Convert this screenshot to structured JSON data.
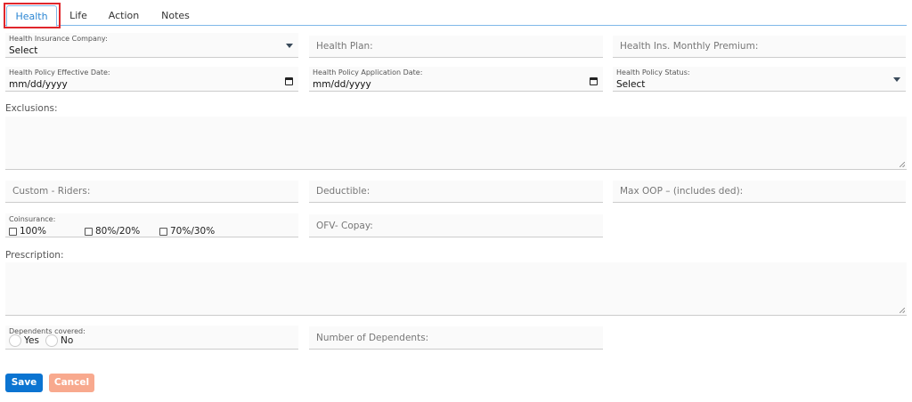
{
  "tabs": [
    "Health",
    "Life",
    "Action",
    "Notes"
  ],
  "fields": {
    "company_label": "Health Insurance Company:",
    "company_value": "Select",
    "plan_placeholder": "Health Plan:",
    "premium_placeholder": "Health Ins. Monthly Premium:",
    "effective_label": "Health Policy Effective Date:",
    "effective_value": "mm/dd/yyyy",
    "application_label": "Health Policy Application Date:",
    "application_value": "mm/dd/yyyy",
    "status_label": "Health Policy Status:",
    "status_value": "Select",
    "exclusions_label": "Exclusions:",
    "riders_placeholder": "Custom - Riders:",
    "deductible_placeholder": "Deductible:",
    "maxoop_placeholder": "Max OOP – (includes ded):",
    "coinsurance_label": "Coinsurance:",
    "coinsurance_options": [
      "100%",
      "80%/20%",
      "70%/30%"
    ],
    "copay_placeholder": "OFV- Copay:",
    "prescription_label": "Prescription:",
    "dependents_label": "Dependents covered:",
    "dependents_options": [
      "Yes",
      "No"
    ],
    "num_dependents_placeholder": "Number of Dependents:"
  },
  "buttons": {
    "save": "Save",
    "cancel": "Cancel"
  },
  "colors": {
    "save": "#0b74d1",
    "cancel": "#f8a98e",
    "active_tab": "#2b86d3",
    "highlight": "#e0262c"
  }
}
